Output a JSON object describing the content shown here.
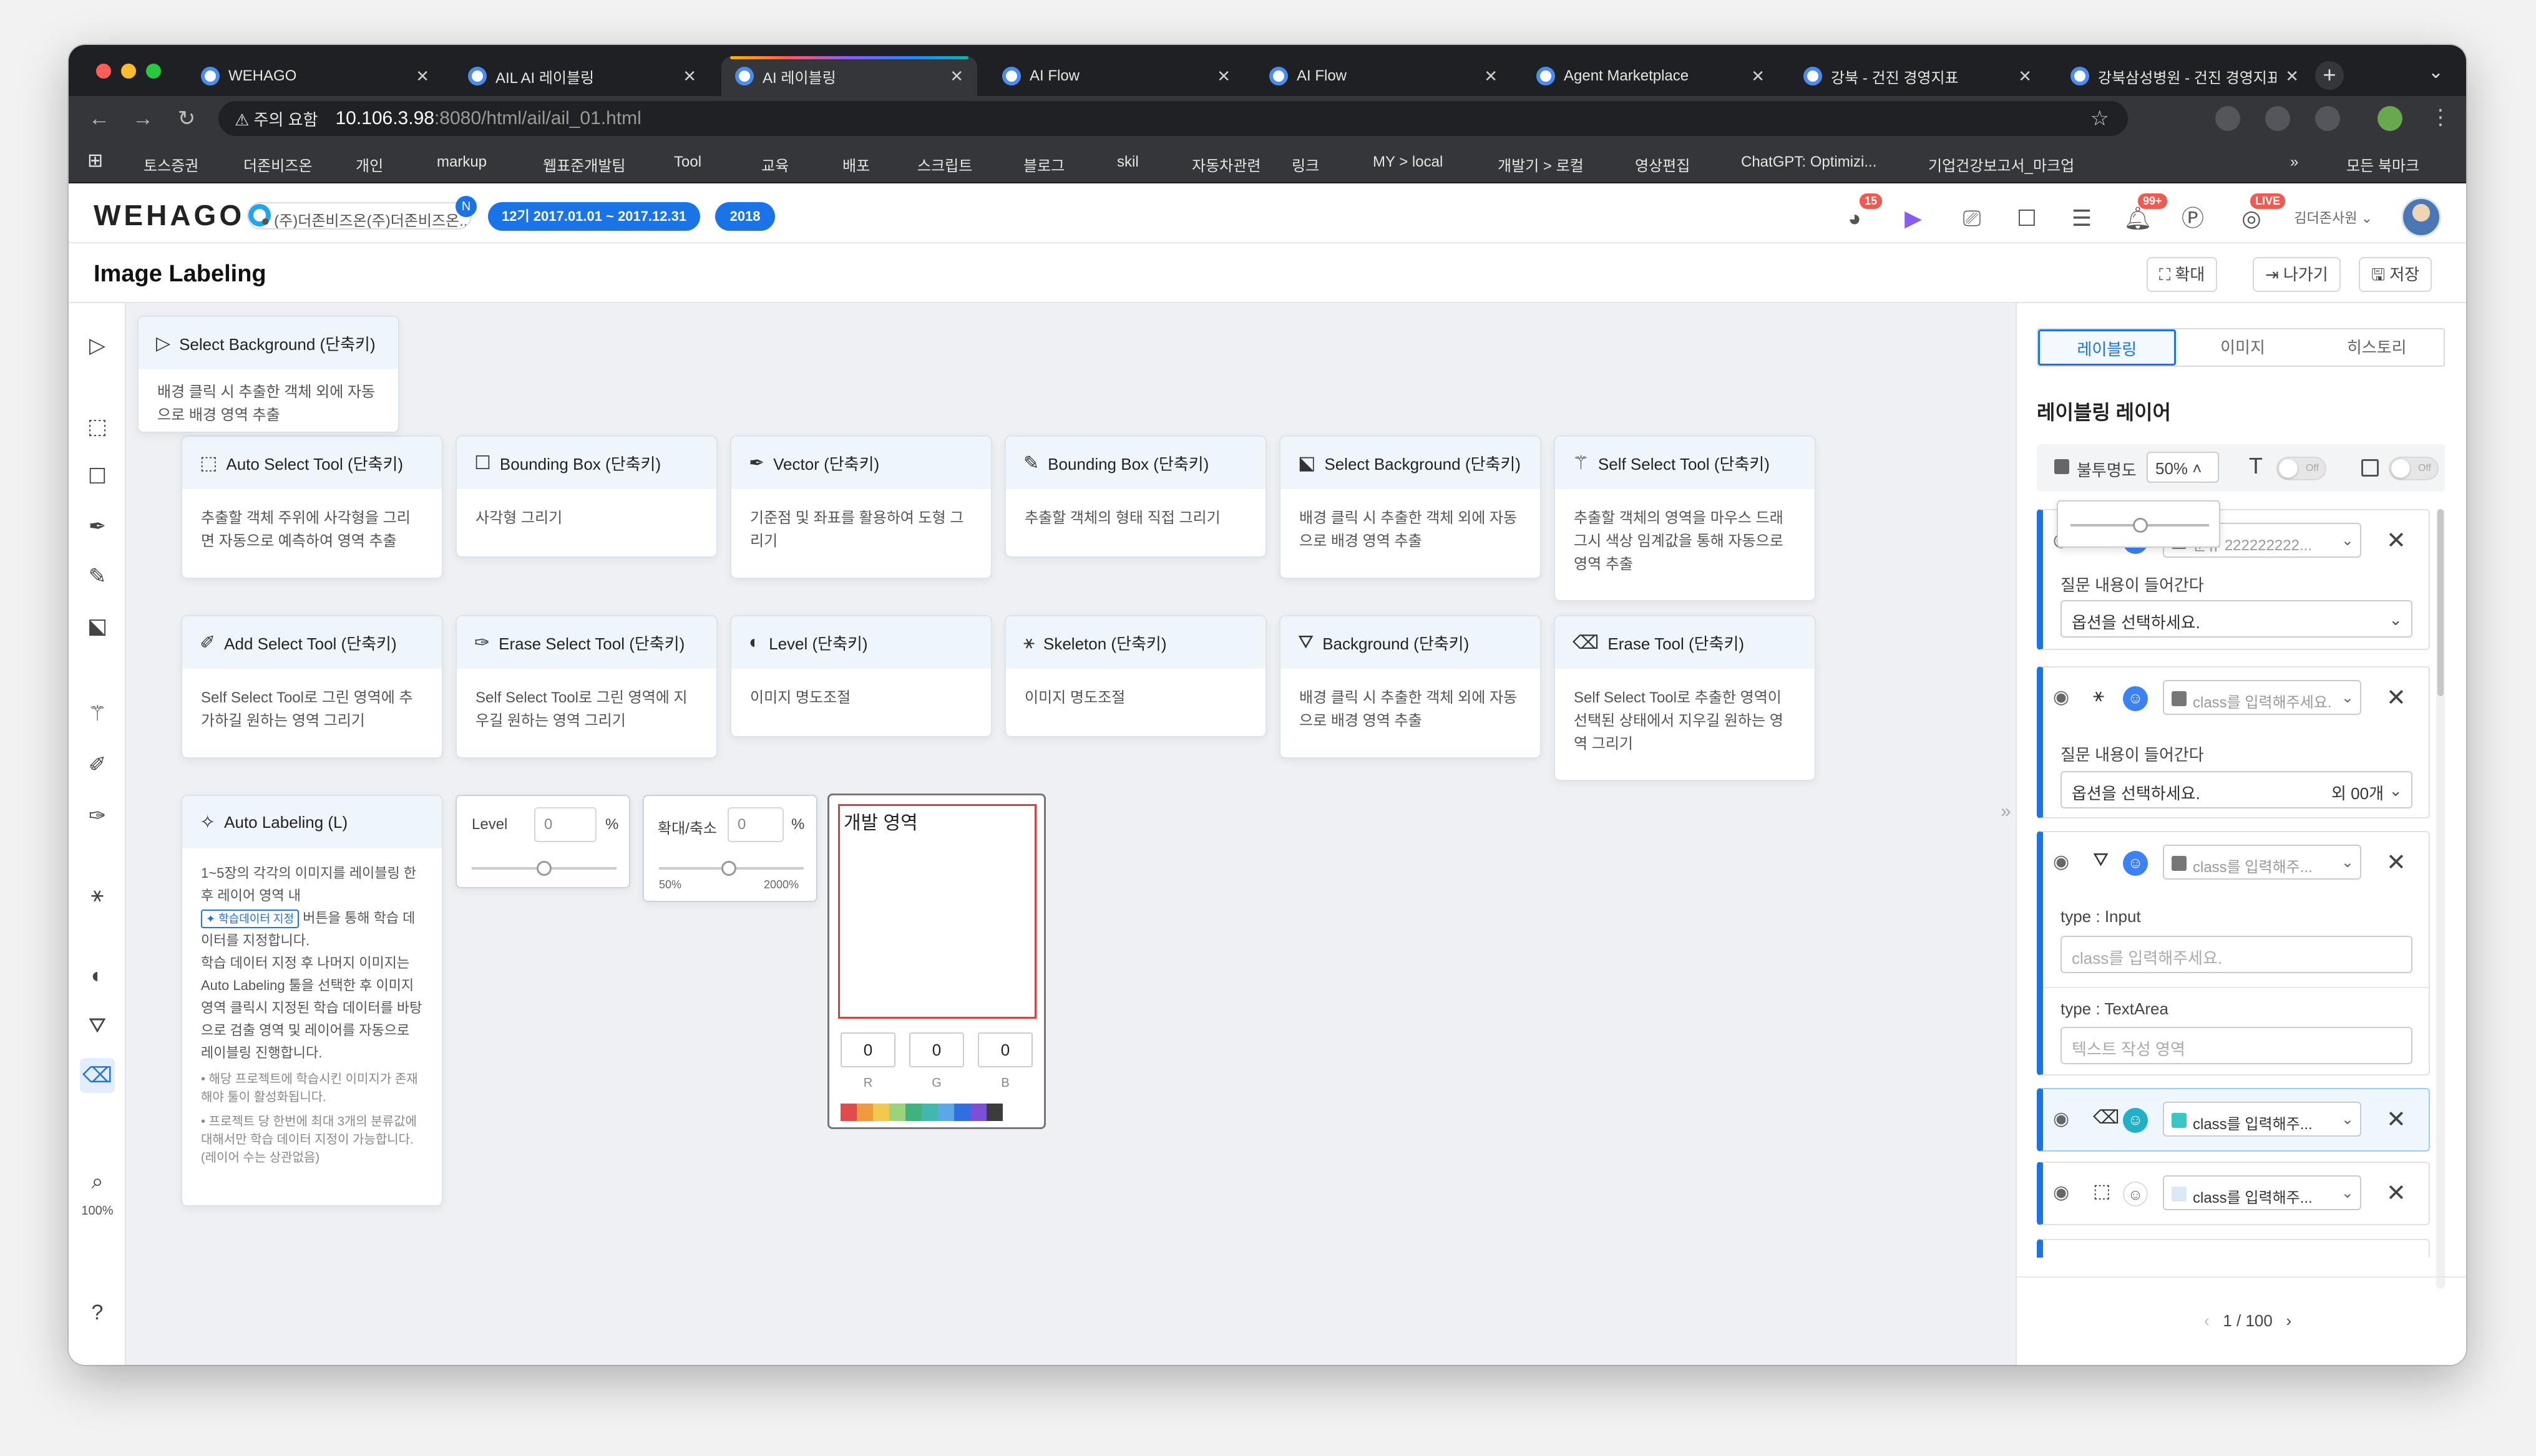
{
  "browser": {
    "tabs": [
      {
        "label": "WEHAGO",
        "active": false
      },
      {
        "label": "AIL AI 레이블링",
        "active": false
      },
      {
        "label": "AI 레이블링",
        "active": true
      },
      {
        "label": "AI Flow",
        "active": false
      },
      {
        "label": "AI Flow",
        "active": false
      },
      {
        "label": "Agent Marketplace",
        "active": false
      },
      {
        "label": "강북 - 건진 경영지표",
        "active": false
      },
      {
        "label": "강북삼성병원 - 건진 경영지표",
        "active": false
      }
    ],
    "security_warning": "주의 요함",
    "url_host": "10.106.3.98",
    "url_path": ":8080/html/ail/ail_01.html",
    "bookmarks": [
      "토스증권",
      "더존비즈온",
      "개인",
      "markup",
      "웹표준개발팀",
      "Tool",
      "교육",
      "배포",
      "스크립트",
      "블로그",
      "skil",
      "자동차관련",
      "링크",
      "MY > local",
      "개발기 > 로컬",
      "영상편집",
      "ChatGPT: Optimizi...",
      "기업건강보고서_마크업"
    ],
    "all_bookmarks": "모든 북마크"
  },
  "header": {
    "logo": "WEHAGO",
    "company": "(주)더존비즈온(주)더존비즈온...",
    "company_badge": "N",
    "fiscal_period": "12기 2017.01.01 ~ 2017.12.31",
    "year": "2018",
    "badges": {
      "apps": "15",
      "notifications": "99+",
      "live": "LIVE"
    },
    "user": "김더존사원"
  },
  "titlebar": {
    "title": "Image Labeling",
    "expand": "확대",
    "exit": "나가기",
    "save": "저장"
  },
  "toolbar": {
    "zoom": "100%"
  },
  "tooltip": {
    "title": "Select Background (단축키)",
    "desc": "배경 클릭 시 추출한 객체 외에 자동으로 배경 영역 추출"
  },
  "cards": [
    {
      "title": "Auto Select Tool (단축키)",
      "desc": "추출할 객체 주위에 사각형을 그리면 자동으로 예측하여 영역 추출"
    },
    {
      "title": "Bounding Box (단축키)",
      "desc": "사각형 그리기"
    },
    {
      "title": "Vector (단축키)",
      "desc": "기준점 및 좌표를 활용하여 도형 그리기"
    },
    {
      "title": "Bounding Box (단축키)",
      "desc": "추출할 객체의 형태 직접 그리기"
    },
    {
      "title": "Select Background (단축키)",
      "desc": "배경 클릭 시 추출한 객체 외에 자동으로 배경 영역 추출"
    },
    {
      "title": "Self Select Tool (단축키)",
      "desc": "추출할 객체의 영역을 마우스 드래그시 색상 임계값을 통해 자동으로 영역 추출"
    },
    {
      "title": "Add Select Tool (단축키)",
      "desc": "Self Select Tool로 그린 영역에 추가하길 원하는 영역 그리기"
    },
    {
      "title": "Erase Select Tool (단축키)",
      "desc": "Self Select Tool로 그린 영역에 지우길 원하는 영역 그리기"
    },
    {
      "title": "Level (단축키)",
      "desc": "이미지 명도조절"
    },
    {
      "title": "Skeleton (단축키)",
      "desc": "이미지 명도조절"
    },
    {
      "title": "Background (단축키)",
      "desc": "배경 클릭 시 추출한 객체 외에 자동으로 배경 영역 추출"
    },
    {
      "title": "Erase Tool (단축키)",
      "desc": "Self Select Tool로 추출한 영역이 선택된 상태에서 지우길 원하는 영역 그리기"
    }
  ],
  "auto_labeling": {
    "title": "Auto Labeling (L)",
    "desc1": "1~5장의 각각의 이미지를 레이블링 한 후 레이어 영역 내",
    "chip": "학습데이터 지정",
    "desc2": "버튼을 통해 학습 데이터를 지정합니다.",
    "desc3": "학습 데이터 지정 후 나머지 이미지는 Auto Labeling 툴을 선택한 후 이미지 영역 클릭시 지정된 학습 데이터를 바탕으로 검출 영역 및 레이어를 자동으로 레이블링 진행합니다.",
    "note1": "• 해당 프로젝트에 학습시킨 이미지가 존재해야 툴이 활성화됩니다.",
    "note2": "• 프로젝트 당 한번에 최대 3개의 분류값에 대해서만 학습 데이터 지정이 가능합니다. (레이어 수는 상관없음)"
  },
  "level_control": {
    "label": "Level",
    "value": "0",
    "unit": "%"
  },
  "zoom_control": {
    "label": "확대/축소",
    "value": "0",
    "unit": "%",
    "min": "50%",
    "max": "2000%"
  },
  "color_picker": {
    "label": "개발 영역",
    "r": "0",
    "g": "0",
    "b": "0",
    "r_label": "R",
    "g_label": "G",
    "b_label": "B",
    "swatches": [
      "#e24b4b",
      "#f09a3e",
      "#f2c94c",
      "#9ad37a",
      "#3fb27f",
      "#40b8b0",
      "#5aa9e6",
      "#2f6fe0",
      "#7b4fd6",
      "#3c3c3c"
    ]
  },
  "panel": {
    "tabs": [
      "레이블링",
      "이미지",
      "히스토리"
    ],
    "heading": "레이블링 레이어",
    "opacity_label": "불투명도",
    "opacity_value": "50%",
    "toggle_off": "Off",
    "layers": [
      {
        "class_placeholder": "분류 222222222...",
        "question": "질문 내용이 들어간다",
        "select": "옵션을 선택하세요."
      },
      {
        "class_placeholder": "class를 입력해주세요.",
        "question": "질문 내용이 들어간다",
        "select": "옵션을 선택하세요.",
        "count": "외 00개"
      },
      {
        "class_placeholder": "class를 입력해주...",
        "input_type_label": "type : Input",
        "input_placeholder": "class를 입력해주세요.",
        "textarea_type_label": "type : TextArea",
        "textarea_placeholder": "텍스트 작성 영역"
      },
      {
        "class_placeholder": "class를 입력해주...",
        "swatch": "#3bc6c6"
      },
      {
        "class_placeholder": "class를 입력해주...",
        "swatch": "#dbe9f7"
      }
    ],
    "pager": "1 / 100"
  }
}
